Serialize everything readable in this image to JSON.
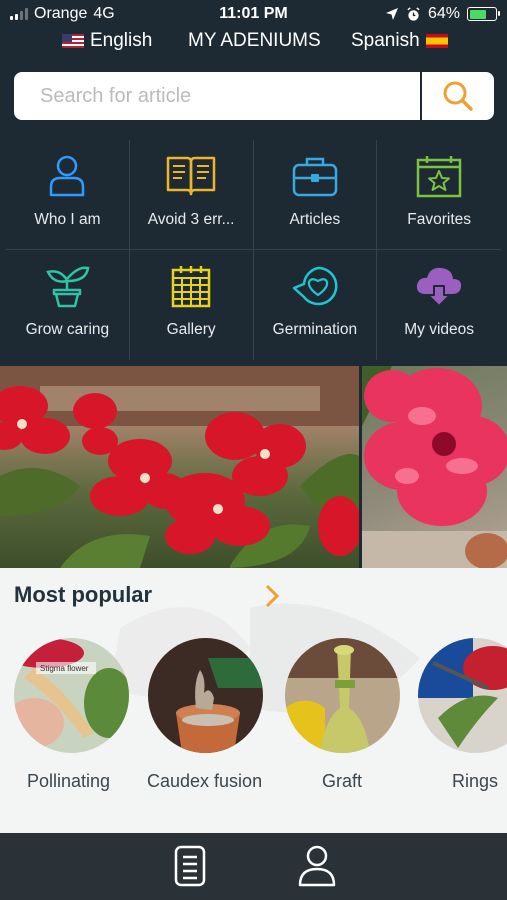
{
  "status": {
    "carrier": "Orange",
    "network": "4G",
    "time": "11:01 PM",
    "battery": "64%",
    "battery_level": 0.64
  },
  "languages": {
    "left": "English",
    "center": "MY ADENIUMS",
    "right": "Spanish"
  },
  "search": {
    "placeholder": "Search for article",
    "icon": "search-icon"
  },
  "menu": [
    {
      "label": "Who I am",
      "icon": "person-icon",
      "color": "#2f9bff"
    },
    {
      "label": "Avoid 3 err...",
      "icon": "open-book-icon",
      "color": "#f0b429"
    },
    {
      "label": "Articles",
      "icon": "briefcase-icon",
      "color": "#38a9e0"
    },
    {
      "label": "Favorites",
      "icon": "calendar-star-icon",
      "color": "#7cc242"
    },
    {
      "label": "Grow caring",
      "icon": "potted-plant-icon",
      "color": "#2ec4a6"
    },
    {
      "label": "Gallery",
      "icon": "calendar-grid-icon",
      "color": "#e8d21d"
    },
    {
      "label": "Germination",
      "icon": "heart-bubble-icon",
      "color": "#1fc6cf"
    },
    {
      "label": "My videos",
      "icon": "cloud-download-icon",
      "color": "#9b5fc0"
    }
  ],
  "popular": {
    "title": "Most popular",
    "items": [
      {
        "label": "Pollinating",
        "photo_caption": "Stigma flower"
      },
      {
        "label": "Caudex fusion"
      },
      {
        "label": "Graft"
      },
      {
        "label": "Rings"
      }
    ]
  },
  "colors": {
    "background": "#1e2a33",
    "accent_orange": "#f0a030",
    "flower_red": "#d8162a",
    "flower_pink": "#e8345f"
  },
  "tabbar": [
    {
      "icon": "document-icon"
    },
    {
      "icon": "user-icon"
    }
  ]
}
